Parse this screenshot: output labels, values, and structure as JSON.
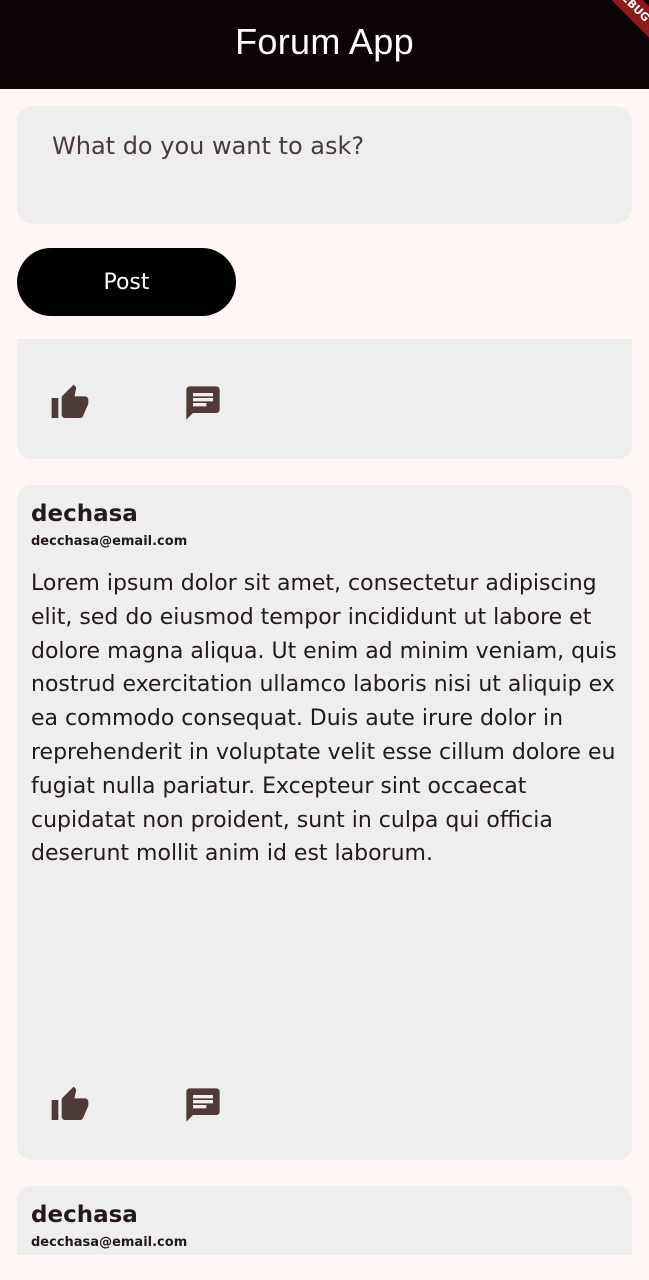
{
  "appbar": {
    "title": "Forum App",
    "debug_banner": "DEBUG"
  },
  "composer": {
    "placeholder": "What do you want to ask?",
    "post_label": "Post"
  },
  "posts": [
    {
      "actions": {
        "like_icon": "thumb-up-icon",
        "comment_icon": "comment-icon"
      }
    },
    {
      "author": "dechasa",
      "email": "decchasa@email.com",
      "body": "Lorem ipsum dolor sit amet, consectetur adipiscing elit, sed do eiusmod tempor incididunt ut labore et dolore magna aliqua. Ut enim ad minim veniam, quis nostrud exercitation ullamco laboris nisi ut aliquip ex ea commodo consequat. Duis aute irure dolor in reprehenderit in voluptate velit esse cillum dolore eu fugiat nulla pariatur. Excepteur sint occaecat cupidatat non proident, sunt in culpa qui officia deserunt mollit anim id est laborum.",
      "actions": {
        "like_icon": "thumb-up-icon",
        "comment_icon": "comment-icon"
      }
    },
    {
      "author": "dechasa",
      "email": "decchasa@email.com"
    }
  ],
  "colors": {
    "appbar": "#0d0505",
    "background": "#fff6f6",
    "card": "#eeeeee",
    "button": "#000000",
    "icon": "#4e3a38"
  }
}
